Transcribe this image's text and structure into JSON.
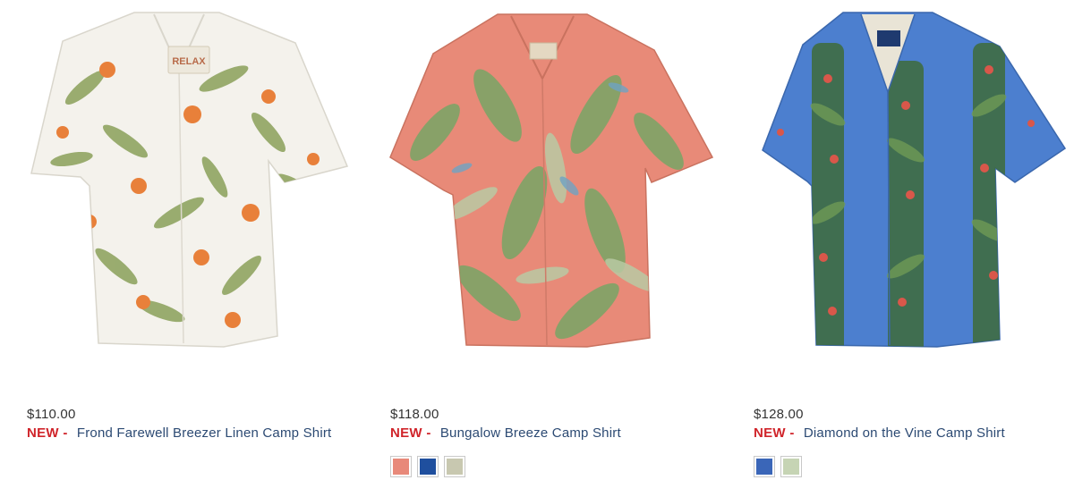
{
  "products": [
    {
      "price": "$110.00",
      "badge": "NEW -",
      "name": "Frond Farewell Breezer Linen Camp Shirt",
      "shirt_colors": {
        "base": "#f4f2ec",
        "accent1": "#e8803a",
        "accent2": "#8aa05a"
      },
      "swatches": []
    },
    {
      "price": "$118.00",
      "badge": "NEW -",
      "name": "Bungalow Breeze Camp Shirt",
      "shirt_colors": {
        "base": "#e88a78",
        "accent1": "#7ea366",
        "accent2": "#b9c9a4"
      },
      "swatches": [
        {
          "color": "#e8897a",
          "name": "coral-swatch"
        },
        {
          "color": "#1f4f9e",
          "name": "blue-swatch"
        },
        {
          "color": "#c8c8b0",
          "name": "sage-swatch"
        }
      ]
    },
    {
      "price": "$128.00",
      "badge": "NEW -",
      "name": "Diamond on the Vine Camp Shirt",
      "shirt_colors": {
        "base": "#4c7fcf",
        "accent1": "#3f6b3a",
        "accent2": "#d9574a"
      },
      "swatches": [
        {
          "color": "#3a66b8",
          "name": "blue-swatch"
        },
        {
          "color": "#c6d4b4",
          "name": "sage-swatch"
        }
      ]
    }
  ],
  "colors": {
    "price_text": "#333333",
    "badge_red": "#d0252b",
    "link_blue": "#2c4a73"
  }
}
